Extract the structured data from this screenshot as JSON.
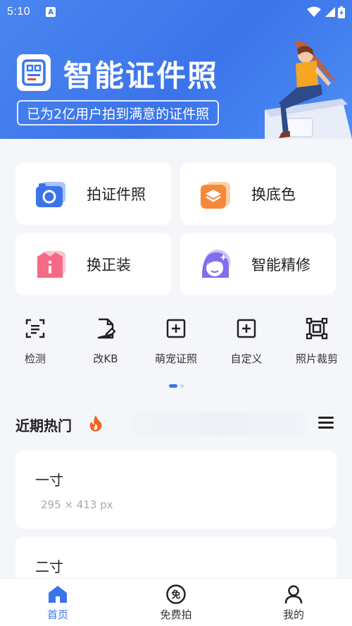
{
  "status": {
    "time": "5:10",
    "a_badge": "A"
  },
  "banner": {
    "title": "智能证件照",
    "subtitle": "已为2亿用户拍到满意的证件照",
    "accent": "#3b74ea"
  },
  "features": [
    {
      "label": "拍证件照",
      "icon": "camera-icon"
    },
    {
      "label": "换底色",
      "icon": "layers-icon"
    },
    {
      "label": "换正装",
      "icon": "suit-icon"
    },
    {
      "label": "智能精修",
      "icon": "face-retouch-icon"
    }
  ],
  "tools": [
    {
      "label": "检测",
      "icon": "scan-icon"
    },
    {
      "label": "改KB",
      "icon": "file-edit-icon"
    },
    {
      "label": "萌宠证照",
      "icon": "add-box-icon"
    },
    {
      "label": "自定义",
      "icon": "add-box-icon"
    },
    {
      "label": "照片裁剪",
      "icon": "crop-icon"
    }
  ],
  "hot": {
    "title": "近期热门",
    "items": [
      {
        "name": "一寸",
        "dims": "295 × 413 px"
      },
      {
        "name": "二寸",
        "dims": ""
      }
    ]
  },
  "nav": {
    "items": [
      {
        "label": "首页",
        "icon": "home-icon"
      },
      {
        "label": "免费拍",
        "icon": "free-shoot-icon"
      },
      {
        "label": "我的",
        "icon": "profile-icon"
      }
    ],
    "free_glyph": "免"
  }
}
